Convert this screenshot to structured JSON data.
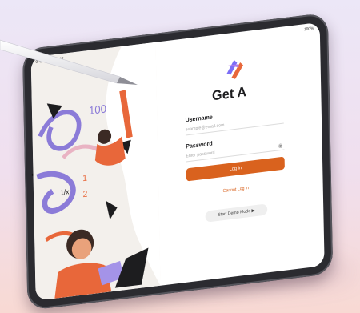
{
  "status": {
    "time": "9:41 Mon Jun 22",
    "indicators": "100%"
  },
  "app": {
    "name": "Get A"
  },
  "form": {
    "username_label": "Username",
    "username_placeholder": "example@email.com",
    "password_label": "Password",
    "password_placeholder": "Enter password",
    "login_label": "Log in",
    "cannot_login_label": "Cannot Log in",
    "demo_label": "Start Demo Mode ▶"
  },
  "illustration": {
    "numbers": "100",
    "fraction_top": "1",
    "fraction_bottom": "2",
    "ratio": "1/x"
  },
  "colors": {
    "accent": "#d9621e",
    "logo_top": "#7b6ef6",
    "logo_bottom": "#e8673a"
  }
}
